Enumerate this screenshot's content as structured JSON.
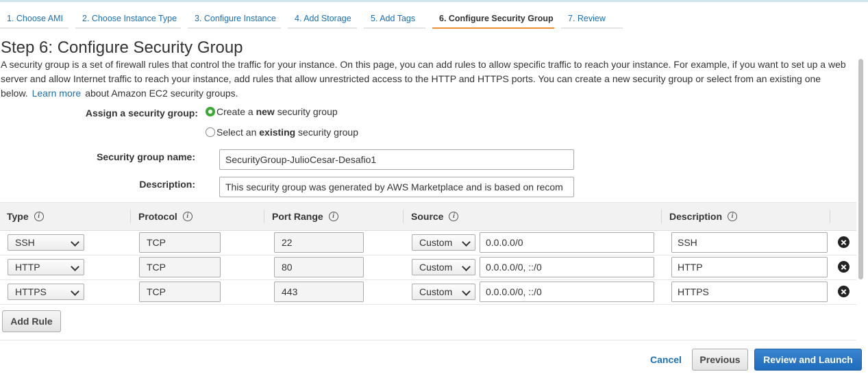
{
  "steps": [
    {
      "label": "1. Choose AMI"
    },
    {
      "label": "2. Choose Instance Type"
    },
    {
      "label": "3. Configure Instance"
    },
    {
      "label": "4. Add Storage"
    },
    {
      "label": "5. Add Tags"
    },
    {
      "label": "6. Configure Security Group",
      "active": true
    },
    {
      "label": "7. Review"
    }
  ],
  "title": "Step 6: Configure Security Group",
  "intro": {
    "text": "A security group is a set of firewall rules that control the traffic for your instance. On this page, you can add rules to allow specific traffic to reach your instance. For example, if you want to set up a web server and allow Internet traffic to reach your instance, add rules that allow unrestricted access to the HTTP and HTTPS ports. You can create a new security group or select from an existing one below.",
    "link": "Learn more",
    "tail": "about Amazon EC2 security groups."
  },
  "assign": {
    "label": "Assign a security group:",
    "options": [
      {
        "pre": "Create a ",
        "bold": "new",
        "post": " security group",
        "checked": true
      },
      {
        "pre": "Select an ",
        "bold": "existing",
        "post": " security group",
        "checked": false
      }
    ]
  },
  "sg_name": {
    "label": "Security group name:",
    "value": "SecurityGroup-JulioCesar-Desafio1"
  },
  "sg_desc": {
    "label": "Description:",
    "value": "This security group was generated by AWS Marketplace and is based on recom"
  },
  "table": {
    "headers": {
      "type": "Type",
      "protocol": "Protocol",
      "port": "Port Range",
      "source": "Source",
      "description": "Description"
    },
    "rows": [
      {
        "type": "SSH",
        "protocol": "TCP",
        "port": "22",
        "source_mode": "Custom",
        "source": "0.0.0.0/0",
        "description": "SSH"
      },
      {
        "type": "HTTP",
        "protocol": "TCP",
        "port": "80",
        "source_mode": "Custom",
        "source": "0.0.0.0/0, ::/0",
        "description": "HTTP"
      },
      {
        "type": "HTTPS",
        "protocol": "TCP",
        "port": "443",
        "source_mode": "Custom",
        "source": "0.0.0.0/0, ::/0",
        "description": "HTTPS"
      }
    ]
  },
  "add_rule": "Add Rule",
  "footer": {
    "cancel": "Cancel",
    "previous": "Previous",
    "review": "Review and Launch"
  },
  "info_glyph": "i",
  "colors": {
    "link": "#1a6fb5",
    "active_tab": "#ec8f2e",
    "primary": "#1f6bbd",
    "radio_checked": "#3aaa35"
  }
}
